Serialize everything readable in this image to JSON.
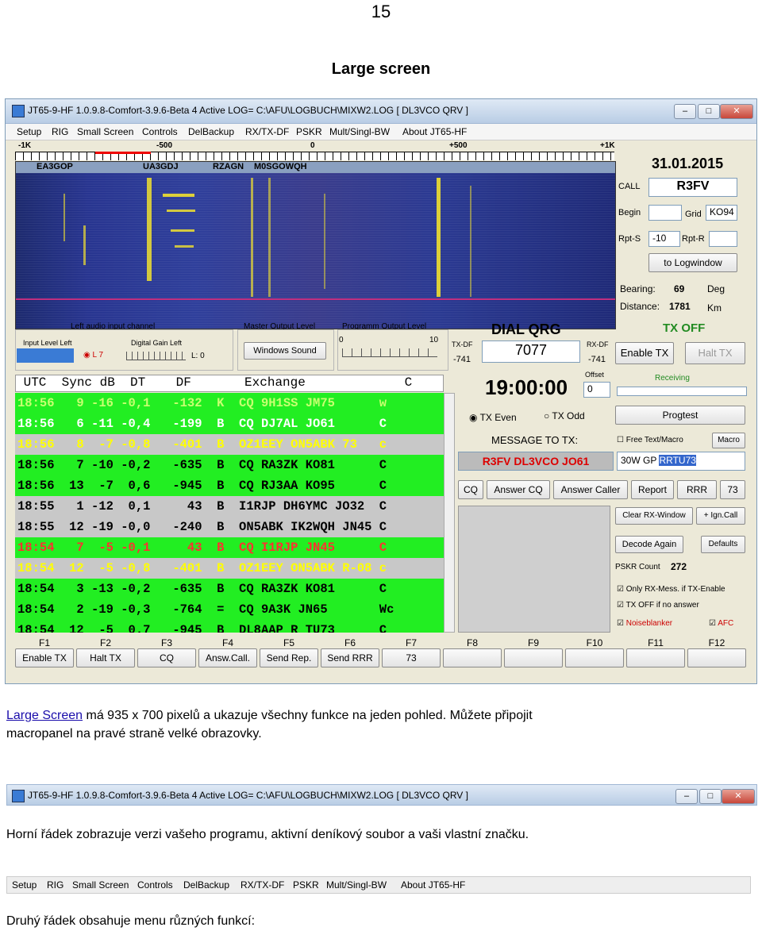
{
  "page_number": "15",
  "heading": "Large screen",
  "window": {
    "title": "JT65-9-HF 1.0.9.8-Comfort-3.9.6-Beta 4 Active LOG= C:\\AFU\\LOGBUCH\\MIXW2.LOG [ DL3VCO QRV ]",
    "controls": [
      "–",
      "□",
      "✕"
    ],
    "menu": [
      "Setup",
      "RIG",
      "Small Screen",
      "Controls",
      "DelBackup",
      "RX/TX-DF",
      "PSKR",
      "Mult/Singl-BW",
      "About JT65-HF"
    ],
    "scale": [
      "-1K",
      "-500",
      "0",
      "+500",
      "+1K"
    ],
    "waterfall_callsigns": [
      "EA3GOP",
      "UA3GDJ",
      "RZAGN",
      "M0SGOWQH"
    ],
    "date": "31.01.2015",
    "call_label": "CALL",
    "call_value": "R3FV",
    "begin_label": "Begin",
    "grid_label": "Grid",
    "grid_value": "KO94",
    "rpts_label": "Rpt-S",
    "rpts_value": "-10",
    "rptr_label": "Rpt-R",
    "to_logwindow": "to Logwindow",
    "bearing_label": "Bearing:",
    "bearing_value": "69",
    "bearing_unit": "Deg",
    "distance_label": "Distance:",
    "distance_value": "1781",
    "distance_unit": "Km",
    "audio_group_label": "Left audio input channel",
    "input_level_label": "Input Level Left",
    "radio_l": "L 7",
    "digital_gain_label": "Digital Gain Left",
    "gain_value": "L: 0",
    "master_output_label": "Master Output Level",
    "windows_sound": "Windows Sound",
    "program_output_label": "Programm Output Level",
    "prog_min": "0",
    "prog_max": "10",
    "dial_qrg_label": "DIAL QRG",
    "dial_qrg_value": "7077",
    "txdf_label": "TX-DF",
    "txdf_value": "-741",
    "rxdf_label": "RX-DF",
    "rxdf_value": "-741",
    "time": "19:00:00",
    "offset_label": "Offset",
    "offset_value": "0",
    "tx_status": "TX OFF",
    "enable_tx": "Enable TX",
    "halt_tx": "Halt TX",
    "receiving": "Receiving",
    "tx_even": "TX Even",
    "tx_odd": "TX Odd",
    "progtest": "Progtest",
    "message_label": "MESSAGE TO TX:",
    "message_value": "R3FV DL3VCO JO61",
    "free_text_label": "Free Text/Macro",
    "macro_btn": "Macro",
    "macro_text": "30W GP ",
    "macro_selected": "RRTU73",
    "action_buttons": [
      "CQ",
      "Answer CQ",
      "Answer Caller",
      "Report",
      "RRR",
      "73"
    ],
    "clear_rx": "Clear RX-Window",
    "ign_call": "+ Ign.Call",
    "decode_again": "Decode Again",
    "defaults": "Defaults",
    "pskr_count_label": "PSKR Count",
    "pskr_count_value": "272",
    "chk_only_rx": "Only RX-Mess. if TX-Enable",
    "chk_tx_off": "TX OFF if no answer",
    "chk_noiseblanker": "Noiseblanker",
    "chk_afc": "AFC",
    "table_header": " UTC  Sync dB  DT    DF       Exchange             C",
    "rows": [
      {
        "text": "18:56   9 -16 -0,1   -132  K  CQ 9H1SS JM75      w",
        "bg": "#22ee22",
        "fg": "#c8ff70"
      },
      {
        "text": "18:56   6 -11 -0,4   -199  B  CQ DJ7AL JO61      C",
        "bg": "#22ee22",
        "fg": "#ffffff"
      },
      {
        "text": "18:56   8  -7 -0,8   -401  B  OZ1EEY ON5ABK 73   c",
        "bg": "#c8c8c8",
        "fg": "#ffff00"
      },
      {
        "text": "18:56   7 -10 -0,2   -635  B  CQ RA3ZK KO81      C",
        "bg": "#22ee22",
        "fg": "#000000"
      },
      {
        "text": "18:56  13  -7  0,6   -945  B  CQ RJ3AA KO95      C",
        "bg": "#22ee22",
        "fg": "#000000"
      },
      {
        "text": "18:55   1 -12  0,1     43  B  I1RJP DH6YMC JO32  C",
        "bg": "#c8c8c8",
        "fg": "#000000"
      },
      {
        "text": "18:55  12 -19 -0,0   -240  B  ON5ABK IK2WQH JN45 C",
        "bg": "#c8c8c8",
        "fg": "#000000"
      },
      {
        "text": "18:54   7  -5 -0,1     43  B  CQ I1RJP JN45      C",
        "bg": "#22ee22",
        "fg": "#ff3030"
      },
      {
        "text": "18:54  12  -5 -0,8   -401  B  OZ1EEY ON5ABK R-08 c",
        "bg": "#c8c8c8",
        "fg": "#ffff00"
      },
      {
        "text": "18:54   3 -13 -0,2   -635  B  CQ RA3ZK KO81      C",
        "bg": "#22ee22",
        "fg": "#000000"
      },
      {
        "text": "18:54   2 -19 -0,3   -764  =  CQ 9A3K JN65       Wc",
        "bg": "#22ee22",
        "fg": "#000000"
      },
      {
        "text": "18:54  12  -5  0.7   -945  B  DL8AAP R TU73      C",
        "bg": "#22ee22",
        "fg": "#000000"
      }
    ],
    "fkeys": [
      {
        "key": "F1",
        "label": "Enable TX"
      },
      {
        "key": "F2",
        "label": "Halt TX"
      },
      {
        "key": "F3",
        "label": "CQ"
      },
      {
        "key": "F4",
        "label": "Answ.Call."
      },
      {
        "key": "F5",
        "label": "Send Rep."
      },
      {
        "key": "F6",
        "label": "Send RRR"
      },
      {
        "key": "F7",
        "label": "73"
      },
      {
        "key": "F8",
        "label": ""
      },
      {
        "key": "F9",
        "label": ""
      },
      {
        "key": "F10",
        "label": ""
      },
      {
        "key": "F11",
        "label": ""
      },
      {
        "key": "F12",
        "label": ""
      }
    ]
  },
  "para1": {
    "link": "Large Screen",
    "rest_line1": " má 935 x 700 pixelů a ukazuje všechny funkce na jeden pohled. Můžete připojit",
    "line2": "macropanel na pravé straně velké obrazovky."
  },
  "strip1_title": "JT65-9-HF 1.0.9.8-Comfort-3.9.6-Beta 4 Active LOG= C:\\AFU\\LOGBUCH\\MIXW2.LOG [ DL3VCO QRV ]",
  "para2": "Horní řádek zobrazuje verzi vašeho programu,  aktivní deníkový soubor a vaši vlastní značku.",
  "para3": "Druhý řádek obsahuje menu různých funkcí:"
}
